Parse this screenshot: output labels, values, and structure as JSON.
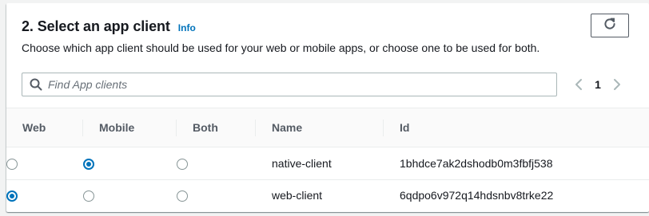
{
  "section": {
    "title": "2. Select an app client",
    "info_label": "Info",
    "description": "Choose which app client should be used for your web or mobile apps, or choose one to be used for both."
  },
  "search": {
    "placeholder": "Find App clients",
    "value": ""
  },
  "pagination": {
    "current_page": "1"
  },
  "icons": {
    "refresh": "refresh-icon",
    "search": "search-icon",
    "prev": "chevron-left-icon",
    "next": "chevron-right-icon"
  },
  "table": {
    "columns": {
      "web": "Web",
      "mobile": "Mobile",
      "both": "Both",
      "name": "Name",
      "id": "Id"
    },
    "rows": [
      {
        "name": "native-client",
        "id": "1bhdce7ak2dshodb0m3fbfj538",
        "web": false,
        "mobile": true,
        "both": false
      },
      {
        "name": "web-client",
        "id": "6qdpo6v972q14hdsnbv8trke22",
        "web": true,
        "mobile": false,
        "both": false
      }
    ]
  },
  "colors": {
    "accent": "#0073bb",
    "text": "#16191f",
    "muted": "#545b64",
    "border": "#eaeded"
  }
}
